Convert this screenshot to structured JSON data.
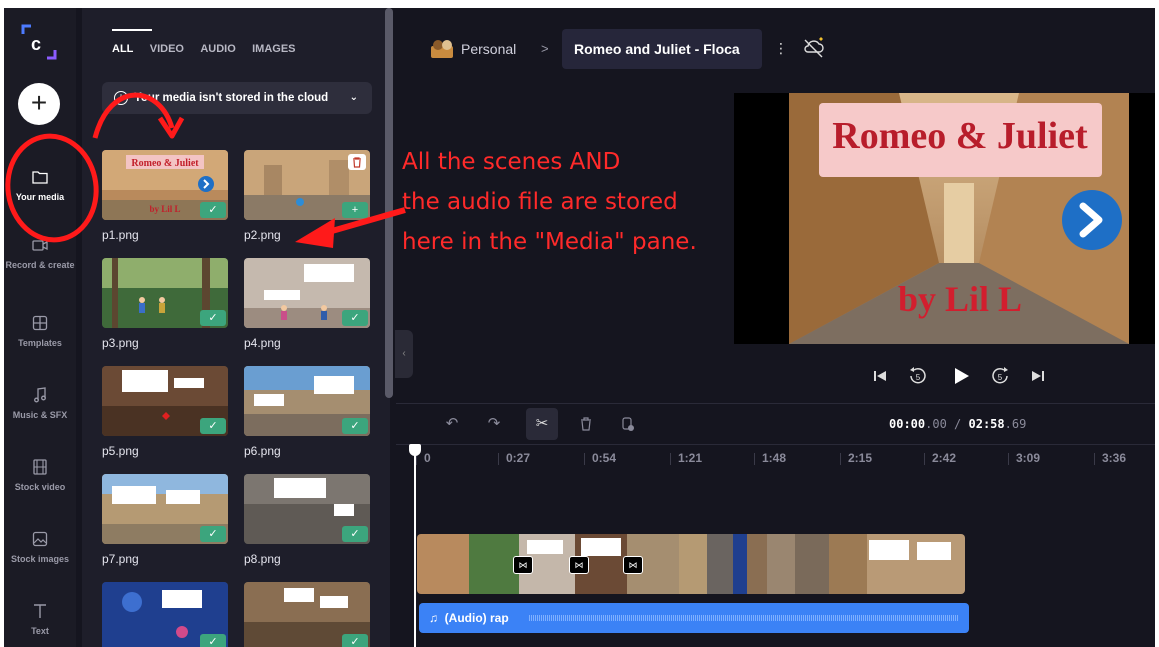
{
  "sidebar": {
    "add_label": "+",
    "items": [
      {
        "label": "Your media",
        "icon": "folder-icon"
      },
      {
        "label": "Record & create",
        "icon": "camera-icon"
      },
      {
        "label": "Templates",
        "icon": "templates-icon"
      },
      {
        "label": "Music & SFX",
        "icon": "music-note-icon"
      },
      {
        "label": "Stock video",
        "icon": "film-icon"
      },
      {
        "label": "Stock images",
        "icon": "image-icon"
      },
      {
        "label": "Text",
        "icon": "text-icon"
      }
    ]
  },
  "media": {
    "tabs": [
      "ALL",
      "VIDEO",
      "AUDIO",
      "IMAGES"
    ],
    "cloud_notice": "Your media isn't stored in the cloud",
    "items": [
      {
        "name": "p1.png",
        "title": "Romeo & Juliet",
        "subtitle": "by Lil L"
      },
      {
        "name": "p2.png"
      },
      {
        "name": "p3.png"
      },
      {
        "name": "p4.png"
      },
      {
        "name": "p5.png"
      },
      {
        "name": "p6.png"
      },
      {
        "name": "p7.png"
      },
      {
        "name": "p8.png"
      }
    ]
  },
  "header": {
    "workspace": "Personal",
    "separator": ">",
    "project_title": "Romeo and Juliet - Floca",
    "menu": "⋮"
  },
  "preview": {
    "title": "Romeo & Juliet",
    "subtitle": "by Lil L"
  },
  "timeline": {
    "current_time": "00:00",
    "current_frac": ".00",
    "separator": " / ",
    "total_time": "02:58",
    "total_frac": ".69",
    "ruler": [
      "0",
      "0:27",
      "0:54",
      "1:21",
      "1:48",
      "2:15",
      "2:42",
      "3:09",
      "3:36"
    ],
    "audio_label": "(Audio) rap"
  },
  "annotation": {
    "line1": "All the scenes AND",
    "line2": "the audio file are stored",
    "line3": "here in the \"Media\" pane."
  },
  "colors": {
    "annotation": "#ff2a2a",
    "accent_green": "#3ca57d",
    "audio_blue": "#3b82f6"
  }
}
